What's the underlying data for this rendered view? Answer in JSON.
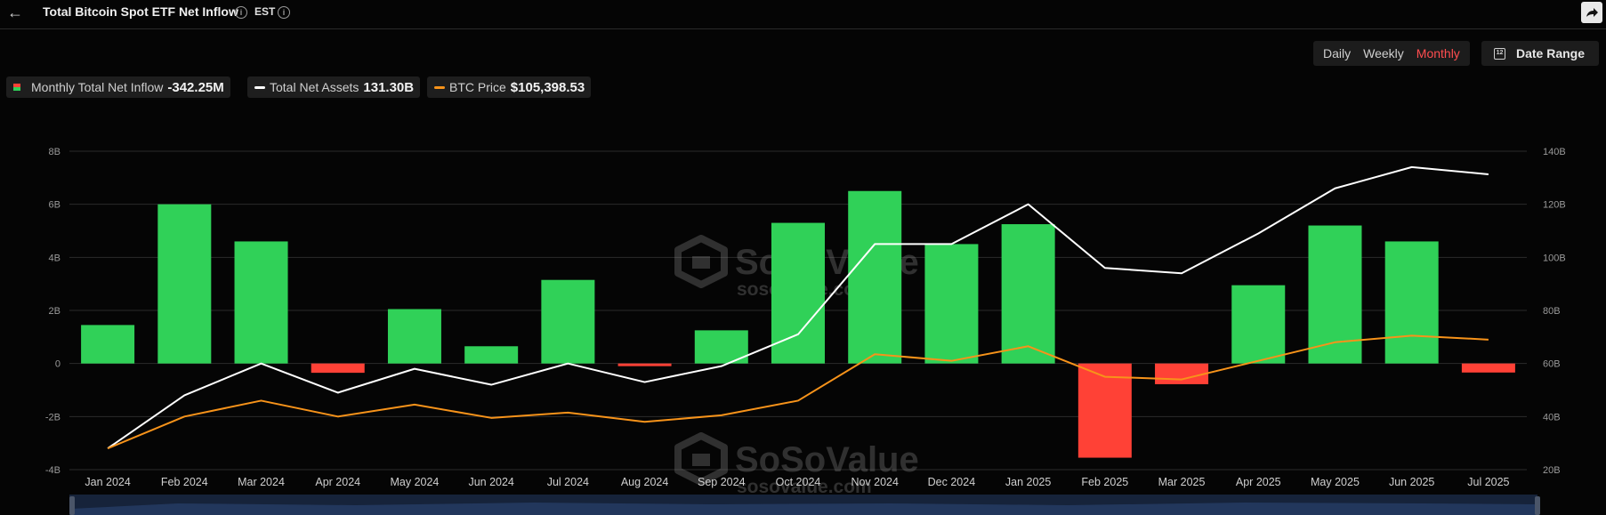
{
  "header": {
    "title": "Total Bitcoin Spot ETF Net Inflow",
    "timezone": "EST"
  },
  "period_toggle": {
    "options": [
      "Daily",
      "Weekly",
      "Monthly"
    ],
    "active": "Monthly"
  },
  "date_range_label": "Date Range",
  "date_range_icon_text": "12",
  "legend": {
    "inflow_label": "Monthly Total Net Inflow",
    "inflow_value": "-342.25M",
    "assets_label": "Total Net Assets",
    "assets_value": "131.30B",
    "price_label": "BTC Price",
    "price_value": "$105,398.53"
  },
  "watermark": {
    "brand": "SoSoValue",
    "url": "sosovalue.com"
  },
  "colors": {
    "positive_bar": "#30d158",
    "negative_bar": "#ff4136",
    "assets_line": "#ffffff",
    "price_line": "#f7931a",
    "active_toggle": "#ff4d4f"
  },
  "chart_data": {
    "type": "bar",
    "categories": [
      "Jan 2024",
      "Feb 2024",
      "Mar 2024",
      "Apr 2024",
      "May 2024",
      "Jun 2024",
      "Jul 2024",
      "Aug 2024",
      "Sep 2024",
      "Oct 2024",
      "Nov 2024",
      "Dec 2024",
      "Jan 2025",
      "Feb 2025",
      "Mar 2025",
      "Apr 2025",
      "May 2025",
      "Jun 2025",
      "Jul 2025"
    ],
    "left_axis": {
      "ticks": [
        "8B",
        "6B",
        "4B",
        "2B",
        "0",
        "-2B",
        "-4B"
      ],
      "ylim": [
        -4,
        8
      ],
      "unit": "B"
    },
    "right_axis": {
      "ticks": [
        "140B",
        "120B",
        "100B",
        "80B",
        "60B",
        "40B",
        "20B"
      ],
      "ylim": [
        20,
        140
      ],
      "unit": "B"
    },
    "series": [
      {
        "name": "Monthly Total Net Inflow",
        "kind": "bar",
        "axis": "left",
        "values": [
          1.45,
          6.0,
          4.6,
          -0.35,
          2.05,
          0.65,
          3.15,
          -0.1,
          1.25,
          5.3,
          6.5,
          4.5,
          5.25,
          -3.55,
          -0.78,
          2.95,
          5.2,
          4.6,
          -0.34
        ]
      },
      {
        "name": "Total Net Assets",
        "kind": "line",
        "axis": "right",
        "values": [
          28,
          48,
          60,
          49,
          58,
          52,
          60,
          53,
          59,
          71,
          105,
          105,
          120,
          96,
          94,
          109,
          126,
          134,
          131.3
        ]
      },
      {
        "name": "BTC Price",
        "kind": "line",
        "axis": "right",
        "values": [
          28,
          40,
          46,
          40,
          44.5,
          39.5,
          41.5,
          38,
          40.5,
          46,
          63.5,
          61,
          66.5,
          55,
          54,
          61,
          68,
          70.5,
          69
        ]
      }
    ],
    "grid": true,
    "legend_position": "top-left"
  }
}
